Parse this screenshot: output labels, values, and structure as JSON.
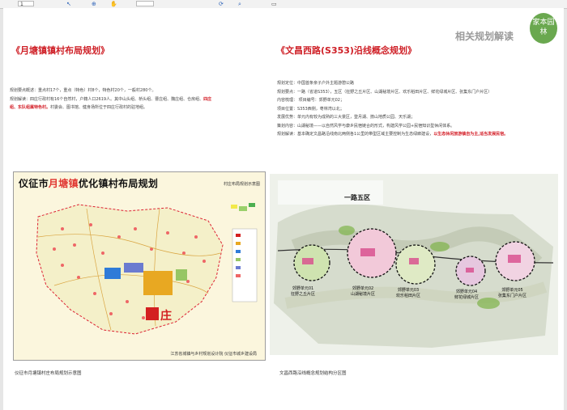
{
  "toolbar": {
    "page_field": "1",
    "zoom_field": "",
    "icons": [
      "arrow-icon",
      "zoom-icon",
      "hand-icon",
      "rotate-icon",
      "search-icon",
      "page-icon"
    ]
  },
  "header": {
    "section_title": "相关规划解读",
    "logo_text": "家本园林"
  },
  "left": {
    "title": "《月塘镇镇村布局规划》",
    "lines": [
      {
        "prefix": "规划要点概述：重点村17个，重点（特色）村8个，特色村20个，一般村280个。",
        "red": ""
      },
      {
        "prefix": "规划解读：四庄行政村有16个自然村，户籍人口2619人。其中山头组、桥头组、曹庄组、魏庄组、仓房组、",
        "red": "四庄"
      },
      {
        "prefix": "",
        "red": "组、东队组属特色村。",
        "suffix": "村委会、图书馆、健身场所位于四庄行政村的驻地组。"
      }
    ],
    "map_title_a": "仪征市",
    "map_title_b": "月塘镇",
    "map_title_c": "优化镇村布局规划",
    "map_subtitle": "村庄布局规划示意图",
    "map_footer": "江苏省城镇与乡村规划设计院  仪征市城乡建设局",
    "map_label": "庄",
    "caption": "仪征市月塘镇村庄布局规划示意图"
  },
  "right": {
    "title": "《文昌西路(S353)沿线概念规划》",
    "lines": [
      {
        "text": "规划定位：中国首条亲子户外主题游憩公路"
      },
      {
        "text": "规划要点：一路（省道S353），五区（狂野之丘片区、山湖秘境片区、欢乐稻田片区、鲜花绿城片区、张集东门户片区）"
      },
      {
        "text": "内容梳理：    项目编号：郊野单元02；"
      },
      {
        "text": "                    项目位置：S353西侧，枣林湾以北；"
      },
      {
        "text": "                    发展优势：单元内有较为成熟的三大景区，登月湖、捺山地质公园、天乐湖；"
      },
      {
        "text": "                    策划内容：山湖秘境——以自然风学与康乡民宿链合的形式，构建风学公园+民宿知识型休闲体系。"
      },
      {
        "prefix": "规划解读：基本确定文昌路沿线南北两侧各1公里的带型区域主要控制为生态绿廊建设，",
        "red": "以生态休闲旅游镇自为主,适当发展民宿。"
      }
    ],
    "map_top_note": "一路五区",
    "units": [
      {
        "label": "郊野单元01",
        "name": "狂野之丘片区"
      },
      {
        "label": "郊野单元02",
        "name": "山湖秘境片区"
      },
      {
        "label": "郊野单元03",
        "name": "欢乐稻田片区"
      },
      {
        "label": "郊野单元04",
        "name": "鲜花绿城片区"
      },
      {
        "label": "郊野单元05",
        "name": "张集东门户片区"
      }
    ],
    "caption": "文昌西路沿线概念规划结构分区图"
  }
}
